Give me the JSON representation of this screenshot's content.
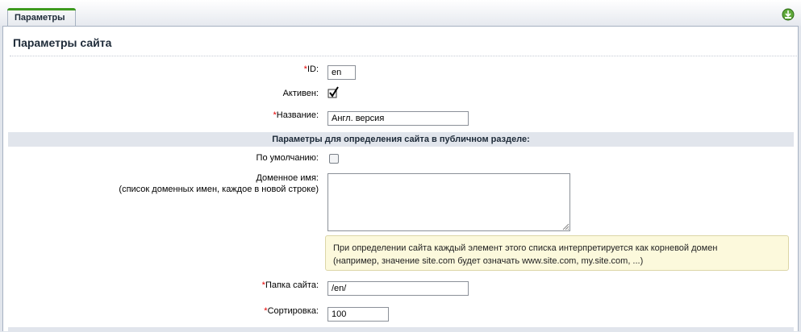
{
  "tab": {
    "label": "Параметры",
    "action_icon": "download-icon"
  },
  "panel": {
    "title": "Параметры сайта"
  },
  "fields": {
    "id": {
      "label": "ID:",
      "value": "en",
      "required": "*"
    },
    "active": {
      "label": "Активен:",
      "checked": true
    },
    "name": {
      "label": "Название:",
      "value": "Англ. версия",
      "required": "*"
    },
    "section_header": "Параметры для определения сайта в публичном разделе:",
    "default": {
      "label": "По умолчанию:",
      "checked": false
    },
    "domain": {
      "label": "Доменное имя:",
      "sublabel": "(список доменных имен, каждое в новой строке)",
      "value": ""
    },
    "hint": {
      "line1": "При определении сайта каждый элемент этого списка интерпретируется как корневой домен",
      "line2": "(например, значение site.com будет означать www.site.com, my.site.com, ...)"
    },
    "folder": {
      "label": "Папка сайта:",
      "value": "/en/",
      "required": "*"
    },
    "sort": {
      "label": "Сортировка:",
      "value": "100",
      "required": "*"
    }
  },
  "colors": {
    "required": "#e40000",
    "tab_accent": "#3d9a1f",
    "hint_bg": "#fcf9dc"
  }
}
